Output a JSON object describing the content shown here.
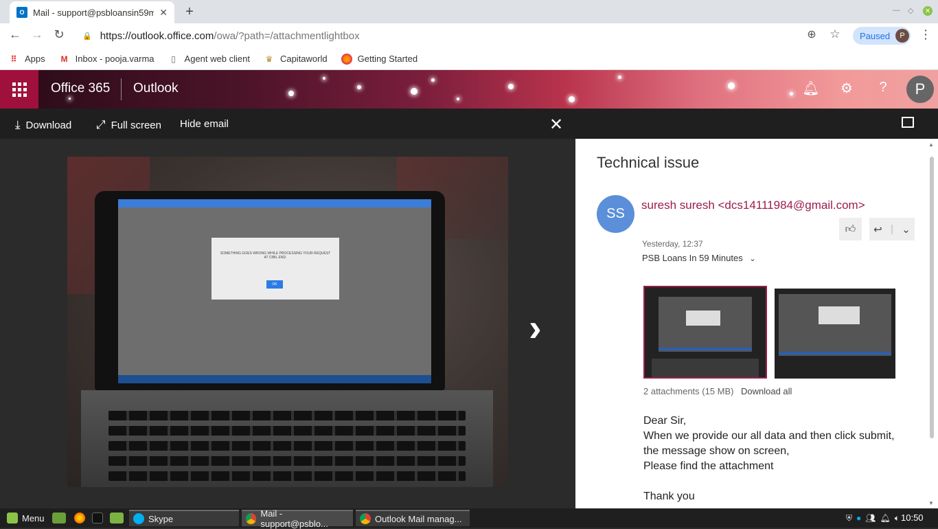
{
  "browser": {
    "tab_title": "Mail - support@psbloansin59m",
    "tab_favicon": "O",
    "new_tab_icon": "+",
    "url_host": "https://outlook.office.com",
    "url_path": "/owa/?path=/attachmentlightbox",
    "profile_status": "Paused",
    "profile_initial": "P"
  },
  "bookmarks": [
    {
      "label": "Apps",
      "icon": "apps-grid-icon"
    },
    {
      "label": "Inbox - pooja.varma",
      "icon": "gmail-icon"
    },
    {
      "label": "Agent web client",
      "icon": "page-icon"
    },
    {
      "label": "Capitaworld",
      "icon": "capitaworld-icon"
    },
    {
      "label": "Getting Started",
      "icon": "firefox-icon"
    }
  ],
  "header": {
    "product": "Office 365",
    "app": "Outlook",
    "user_initial": "P"
  },
  "lightbox": {
    "download": "Download",
    "full_screen": "Full screen",
    "hide_email": "Hide email",
    "close": "✕"
  },
  "photo_screen_dialog": {
    "message": "SOMETHING GOES WRONG WHILE PROCESSING YOUR REQUEST AT CIBIL END.",
    "ok": "OK"
  },
  "email": {
    "subject": "Technical issue",
    "sender_initials": "SS",
    "sender": "suresh suresh <dcs14111984@gmail.com>",
    "timestamp": "Yesterday, 12:37",
    "recipient": "PSB Loans In 59 Minutes",
    "attachments_count": "2 attachments (15 MB)",
    "download_all": "Download all",
    "body": [
      "Dear Sir,",
      "When we provide our all data and then click submit,",
      "the message show on screen,",
      "Please find the attachment",
      "",
      "Thank you"
    ]
  },
  "taskbar": {
    "menu": "Menu",
    "apps": [
      {
        "label": "Skype"
      },
      {
        "label": "Mail - support@psblo..."
      },
      {
        "label": "Outlook Mail manag..."
      }
    ],
    "clock": "10:50"
  },
  "colors": {
    "accent": "#9b1c4d",
    "waffle_bg": "#a0103c",
    "avatar_blue": "#5b8fd9",
    "chrome_blue": "#1a73e8"
  }
}
